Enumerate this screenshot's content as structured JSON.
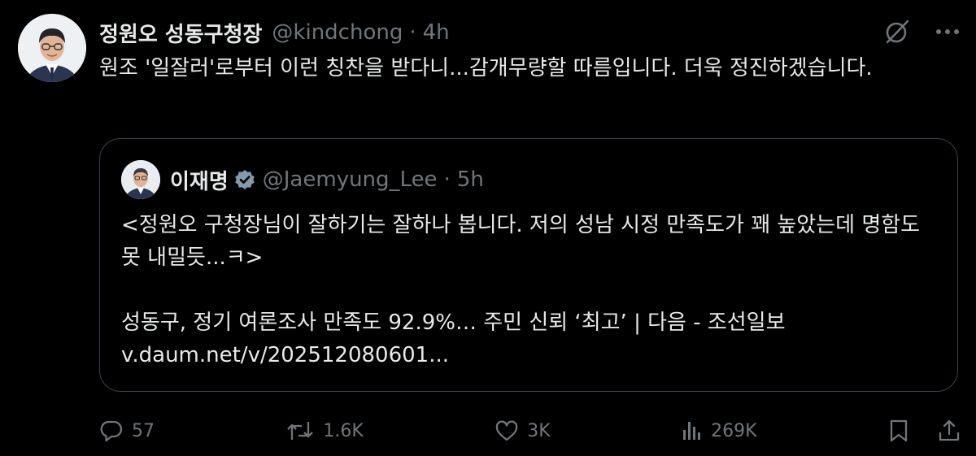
{
  "tweet": {
    "display_name": "정원오 성동구청장",
    "handle": "@kindchong",
    "separator": "·",
    "time": "4h",
    "text": "원조 '일잘러'로부터 이런 칭찬을 받다니...감개무량할 따름입니다. 더욱 정진하겠습니다."
  },
  "quoted": {
    "display_name": "이재명",
    "handle": "@Jaemyung_Lee",
    "separator": "·",
    "time": "5h",
    "text": "<정원오 구청장님이 잘하기는 잘하나 봅니다. 저의 성남 시정 만족도가 꽤 높았는데 명함도 못 내밀듯...ㅋ>",
    "link_title": "성동구, 정기 여론조사 만족도 92.9%… 주민 신뢰 ‘최고’ | 다음 - 조선일보",
    "link_url": "v.daum.net/v/202512080601..."
  },
  "actions": {
    "replies": "57",
    "reposts": "1.6K",
    "likes": "3K",
    "views": "269K"
  },
  "icons": {
    "top_right": [
      "grok-icon",
      "more-icon"
    ],
    "verified": "verified-badge-icon",
    "action_bar": [
      "reply-icon",
      "repost-icon",
      "like-icon",
      "views-icon",
      "bookmark-icon",
      "share-icon"
    ]
  },
  "colors": {
    "background": "#000000",
    "text_primary": "#e7e9ea",
    "text_secondary": "#71767b",
    "border": "#38444d",
    "verified_badge": "#829aab"
  }
}
